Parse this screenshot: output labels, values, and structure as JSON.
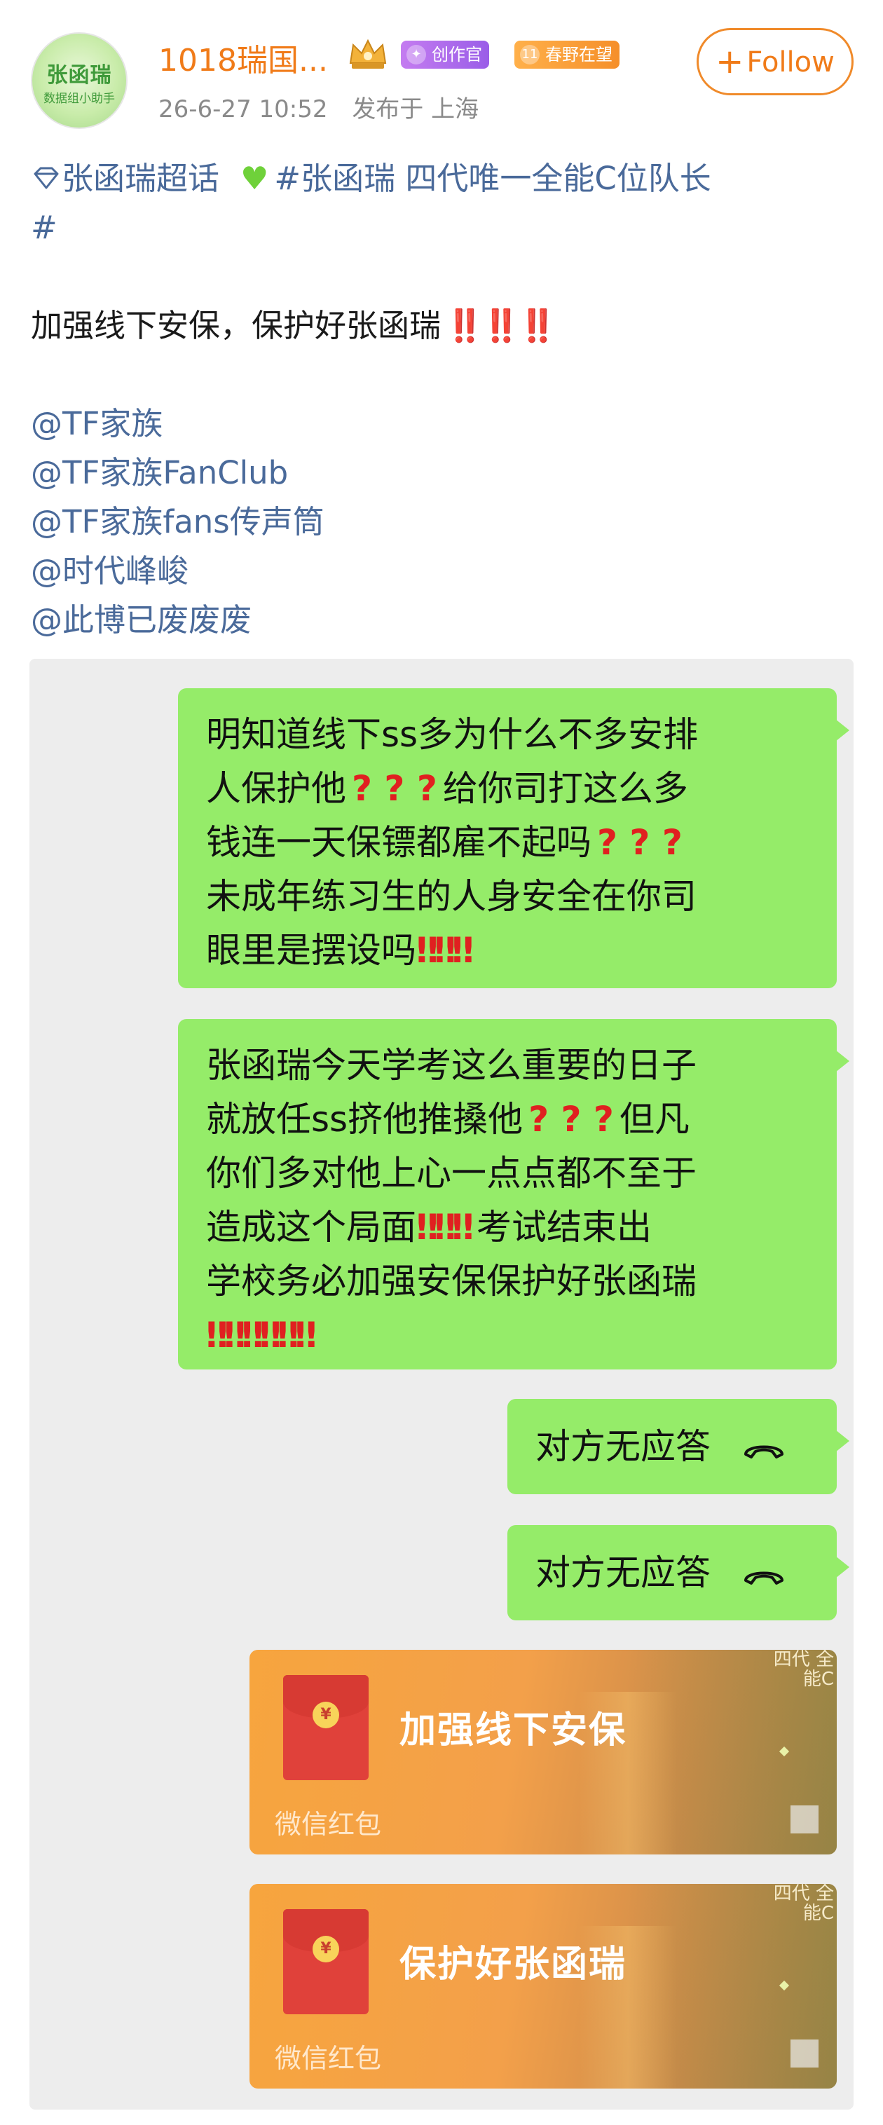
{
  "post": {
    "username": "1018瑞国...",
    "badge_creator": "创作官",
    "badge_spring": "春野在望",
    "badge_spring_num": "11",
    "datetime": "26-6-27 10:52",
    "location": "发布于 上海",
    "follow_label": "Follow",
    "avatar_line1": "张函瑞",
    "avatar_line2": "数据组小助手",
    "supertopic": "张函瑞超话",
    "hashtag_line1": "#张函瑞 四代唯一全能C位队长",
    "hashtag_line2": "#",
    "main_text": "加强线下安保，保护好张函瑞",
    "main_marks": "‼️‼️‼️",
    "mentions": [
      "@TF家族",
      "@TF家族FanClub",
      "@TF家族fans传声筒",
      "@时代峰峻",
      "@此博已废废废"
    ]
  },
  "chat": {
    "bubble1": {
      "l1": "明知道线下ss多为什么不多安排",
      "l2a": "人保护他",
      "l2q": "? ? ?",
      "l2b": "给你司打这么多",
      "l3a": "钱连一天保镖都雇不起吗",
      "l3q": "? ? ?",
      "l4": "未成年练习生的人身安全在你司",
      "l5a": "眼里是摆设吗",
      "l5e": "‼‼‼"
    },
    "bubble2": {
      "l1": "张函瑞今天学考这么重要的日子",
      "l2a": "就放任ss挤他推搡他",
      "l2q": "? ? ?",
      "l2b": "但凡",
      "l3": "你们多对他上心一点点都不至于",
      "l4a": "造成这个局面",
      "l4e": "‼‼‼",
      "l4b": "考试结束出",
      "l5": "学校务必加强安保保护好张函瑞",
      "l6e": "‼‼‼‼‼‼"
    },
    "no_answer": "对方无应答",
    "red_packet_1": "加强线下安保",
    "red_packet_2": "保护好张函瑞",
    "red_packet_label": "微信红包",
    "red_packet_deco": "四代 全能C"
  },
  "colors": {
    "username": "#f07b19",
    "link": "#4a6a9a",
    "bubble": "#95ec69",
    "chat_bg": "#ededed",
    "red_packet": "#f7a53e",
    "alert_red": "#e02020"
  }
}
